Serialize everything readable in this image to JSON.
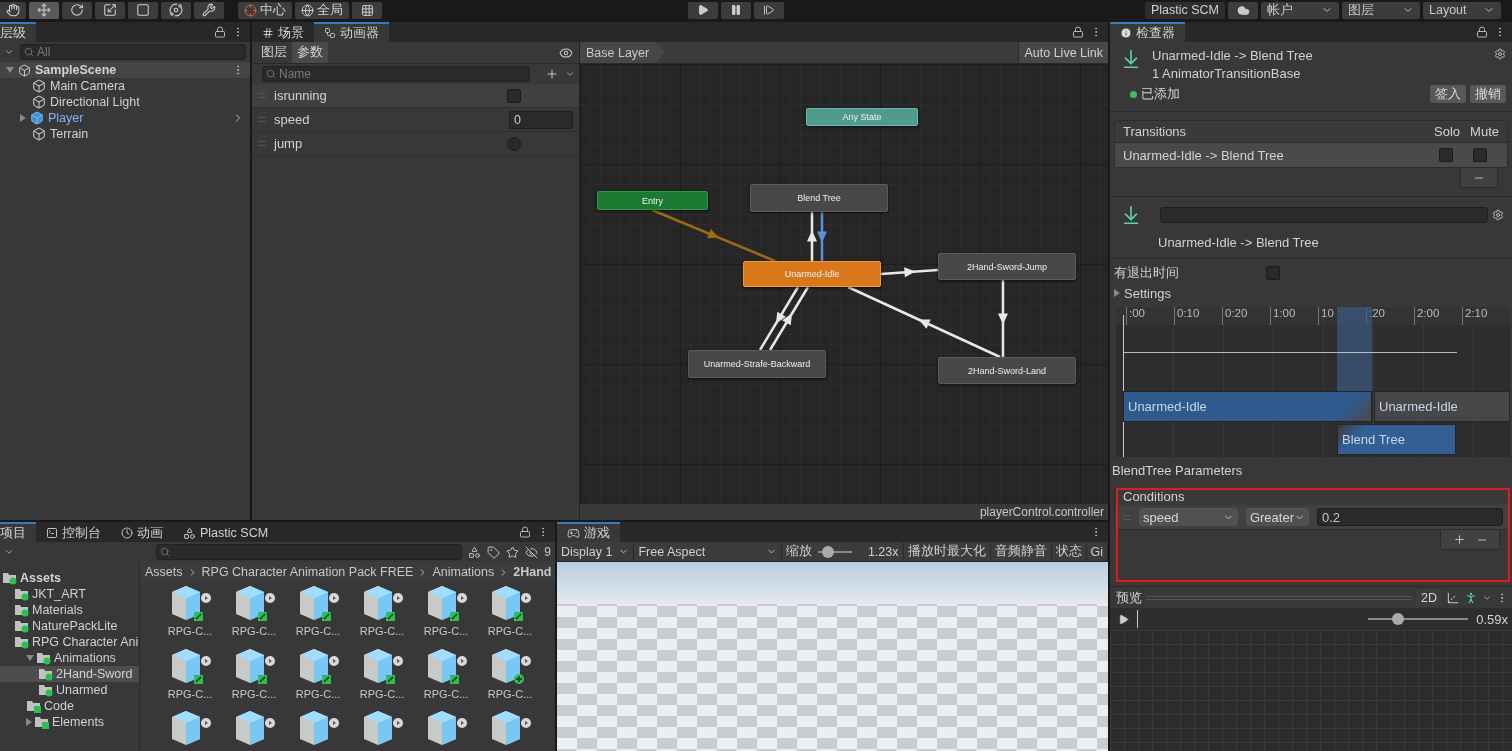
{
  "toolbar": {
    "tools": [
      {
        "kind": "hand",
        "selected": false
      },
      {
        "kind": "move",
        "selected": true
      },
      {
        "kind": "rotate",
        "selected": false
      },
      {
        "kind": "scale",
        "selected": false
      },
      {
        "kind": "rect",
        "selected": false
      },
      {
        "kind": "transform",
        "selected": false
      },
      {
        "kind": "custom",
        "selected": false
      }
    ],
    "pivot": "中心",
    "space": "全局",
    "plastic": "Plastic SCM",
    "account": "帐户",
    "layers": "图层",
    "layout": "Layout"
  },
  "hierarchy": {
    "tab": "层级",
    "search": {
      "placeholder": "All"
    },
    "scene": "SampleScene",
    "items": [
      {
        "label": "Main Camera",
        "kind": "object"
      },
      {
        "label": "Directional Light",
        "kind": "object"
      },
      {
        "label": "Player",
        "kind": "prefab"
      },
      {
        "label": "Terrain",
        "kind": "object"
      }
    ]
  },
  "animator": {
    "tabs": [
      {
        "label": "场景",
        "kind": "scene",
        "selected": false
      },
      {
        "label": "动画器",
        "kind": "animator",
        "selected": true
      }
    ],
    "subtabs": [
      {
        "label": "图层",
        "selected": false
      },
      {
        "label": "参数",
        "selected": true
      }
    ],
    "search": {
      "placeholder": "Name"
    },
    "parameters": [
      {
        "name": "isrunning",
        "kind": "bool",
        "checked": false
      },
      {
        "name": "speed",
        "kind": "float",
        "value": "0"
      },
      {
        "name": "jump",
        "kind": "trigger",
        "checked": false
      }
    ],
    "layer": "Base Layer",
    "live_link": "Auto Live Link",
    "states": [
      {
        "label": "Any State",
        "kind": "any",
        "selected": false
      },
      {
        "label": "Entry",
        "kind": "entry",
        "selected": false
      },
      {
        "label": "Blend Tree",
        "kind": "state",
        "selected": false
      },
      {
        "label": "Unarmed-Idle",
        "kind": "state",
        "selected": true
      },
      {
        "label": "2Hand-Sword-Jump",
        "kind": "state",
        "selected": false
      },
      {
        "label": "Unarmed-Strafe-Backward",
        "kind": "state",
        "selected": false
      },
      {
        "label": "2Hand-Sword-Land",
        "kind": "state",
        "selected": false
      }
    ],
    "file": "playerControl.controller"
  },
  "inspector": {
    "tab": "检查器",
    "title": "Unarmed-Idle -> Blend Tree",
    "subtitle": "1 AnimatorTransitionBase",
    "status": "已添加",
    "actions": [
      "签入",
      "撤销"
    ],
    "transitions": {
      "header": "Transitions",
      "solo": "Solo",
      "mute": "Mute",
      "rows": [
        {
          "label": "Unarmed-Idle -> Blend Tree",
          "solo": false,
          "mute": false
        }
      ]
    },
    "transition_name": "Unarmed-Idle -> Blend Tree",
    "has_exit_time": {
      "label": "有退出时间",
      "checked": false
    },
    "settings": {
      "label": "Settings",
      "expanded": false
    },
    "timeline": {
      "ticks": [
        ":00",
        "0:10",
        "0:20",
        "1:00",
        "10",
        ":20",
        "2:00",
        "2:10"
      ],
      "bars": [
        {
          "label": "Unarmed-Idle",
          "kind": "source"
        },
        {
          "label": "Unarmed-Idle",
          "kind": "source_after"
        },
        {
          "label": "Blend Tree",
          "kind": "destination"
        }
      ]
    },
    "blend_params": "BlendTree Parameters",
    "conditions": {
      "header": "Conditions",
      "rows": [
        {
          "parameter": "speed",
          "mode": "Greater",
          "value": "0.2"
        }
      ]
    },
    "preview": {
      "title": "预览",
      "mode": "2D",
      "level": 0.3,
      "reading": "0.59x"
    }
  },
  "project": {
    "tabs": [
      {
        "label": "项目",
        "kind": "project",
        "selected": true
      },
      {
        "label": "控制台",
        "kind": "console",
        "selected": false
      },
      {
        "label": "动画",
        "kind": "animation",
        "selected": false
      },
      {
        "label": "Plastic SCM",
        "kind": "plastic",
        "selected": false
      }
    ],
    "hidden_count": "9",
    "tree": [
      {
        "label": "Assets",
        "kind": "added",
        "selected": false,
        "children": [
          {
            "label": "JKT_ART",
            "kind": "added",
            "selected": false
          },
          {
            "label": "Materials",
            "kind": "added",
            "selected": false
          },
          {
            "label": "NaturePackLite",
            "kind": "added",
            "selected": false
          },
          {
            "label": "RPG Character Ani",
            "kind": "added",
            "selected": false,
            "children": [
              {
                "label": "Animations",
                "kind": "added",
                "selected": false,
                "expanded": true,
                "children": [
                  {
                    "label": "2Hand-Sword",
                    "kind": "added",
                    "selected": true
                  },
                  {
                    "label": "Unarmed",
                    "kind": "added",
                    "selected": false
                  }
                ]
              },
              {
                "label": "Code",
                "kind": "synced",
                "selected": false
              },
              {
                "label": "Elements",
                "kind": "synced",
                "selected": false,
                "expanded": false
              }
            ]
          }
        ]
      }
    ],
    "breadcrumb": [
      "Assets",
      "RPG Character Animation Pack FREE",
      "Animations",
      "2Hand"
    ],
    "assets": [
      {
        "label": "RPG-C...",
        "kind": "synced"
      },
      {
        "label": "RPG-C...",
        "kind": "synced"
      },
      {
        "label": "RPG-C...",
        "kind": "synced"
      },
      {
        "label": "RPG-C...",
        "kind": "synced"
      },
      {
        "label": "RPG-C...",
        "kind": "synced"
      },
      {
        "label": "RPG-C...",
        "kind": "synced"
      },
      {
        "label": "RPG-C...",
        "kind": "synced"
      },
      {
        "label": "RPG-C...",
        "kind": "synced"
      },
      {
        "label": "RPG-C...",
        "kind": "synced"
      },
      {
        "label": "RPG-C...",
        "kind": "synced"
      },
      {
        "label": "RPG-C...",
        "kind": "synced"
      },
      {
        "label": "RPG-C...",
        "kind": "added"
      },
      {
        "kind": "plain"
      },
      {
        "kind": "plain"
      },
      {
        "kind": "plain"
      },
      {
        "kind": "plain"
      },
      {
        "kind": "plain"
      },
      {
        "kind": "plain"
      }
    ]
  },
  "game": {
    "tab": "游戏",
    "display": "Display 1",
    "aspect": "Free Aspect",
    "scale": {
      "label": "缩放",
      "level": 0.3,
      "reading": "1.23x"
    },
    "toggles": [
      "播放时最大化",
      "音频静音",
      "状态",
      "Gi"
    ]
  }
}
